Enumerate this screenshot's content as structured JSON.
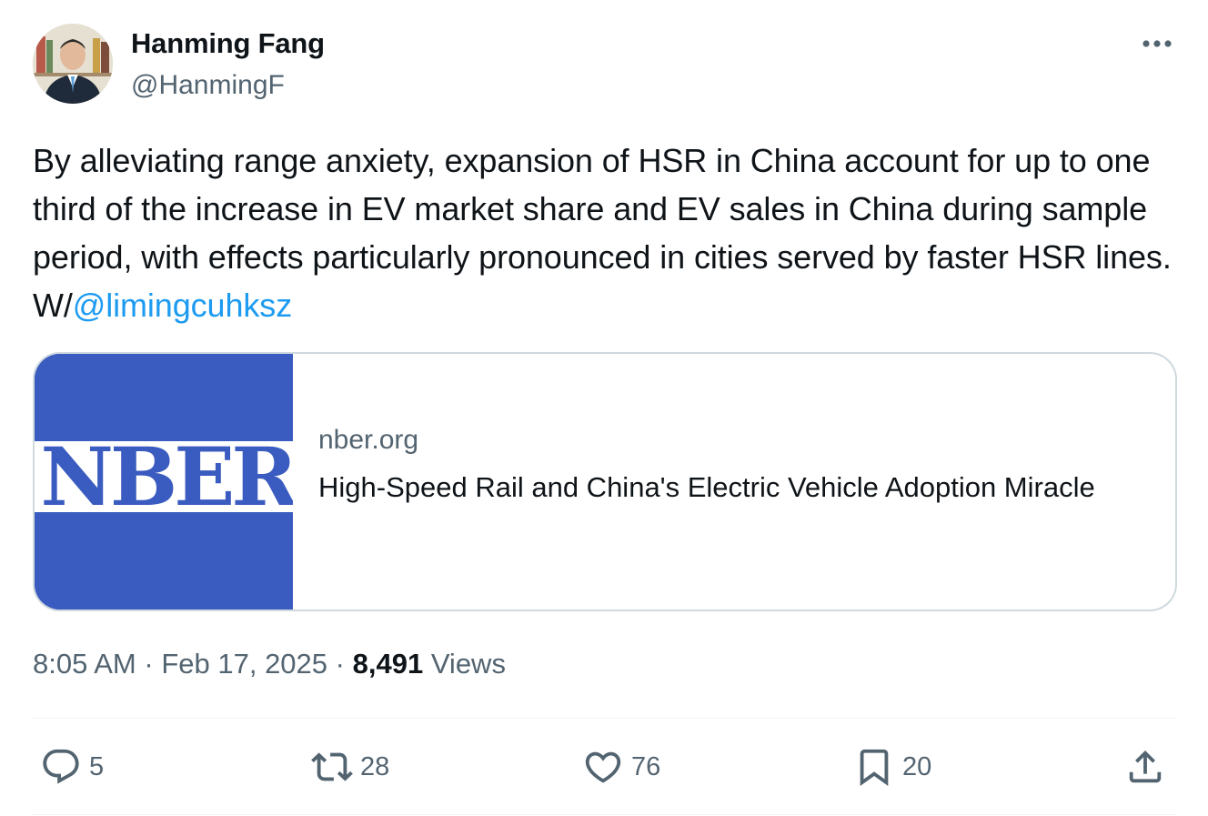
{
  "author": {
    "display_name": "Hanming Fang",
    "handle": "@HanmingF"
  },
  "tweet": {
    "text": "By alleviating range anxiety, expansion of HSR in China account for up to one third of the increase in EV market share and EV sales in China during sample period, with effects particularly pronounced in cities served by faster HSR lines. W/",
    "mention": "@limingcuhksz"
  },
  "card": {
    "image_text": "NBER",
    "domain": "nber.org",
    "title": "High-Speed Rail and China's Electric Vehicle Adoption Miracle"
  },
  "meta": {
    "time": "8:05 AM",
    "separator": "·",
    "date": "Feb 17, 2025",
    "views_count": "8,491",
    "views_label": "Views"
  },
  "actions": {
    "replies": "5",
    "reposts": "28",
    "likes": "76",
    "bookmarks": "20"
  },
  "icons": {
    "more": "more-horizontal-icon",
    "reply": "reply-icon",
    "repost": "repost-icon",
    "like": "heart-icon",
    "bookmark": "bookmark-icon",
    "share": "share-icon"
  },
  "colors": {
    "text": "#0f1419",
    "secondary": "#536471",
    "link": "#1d9bf0",
    "border": "#cfd9de",
    "nber_blue": "#3a5bbf"
  }
}
